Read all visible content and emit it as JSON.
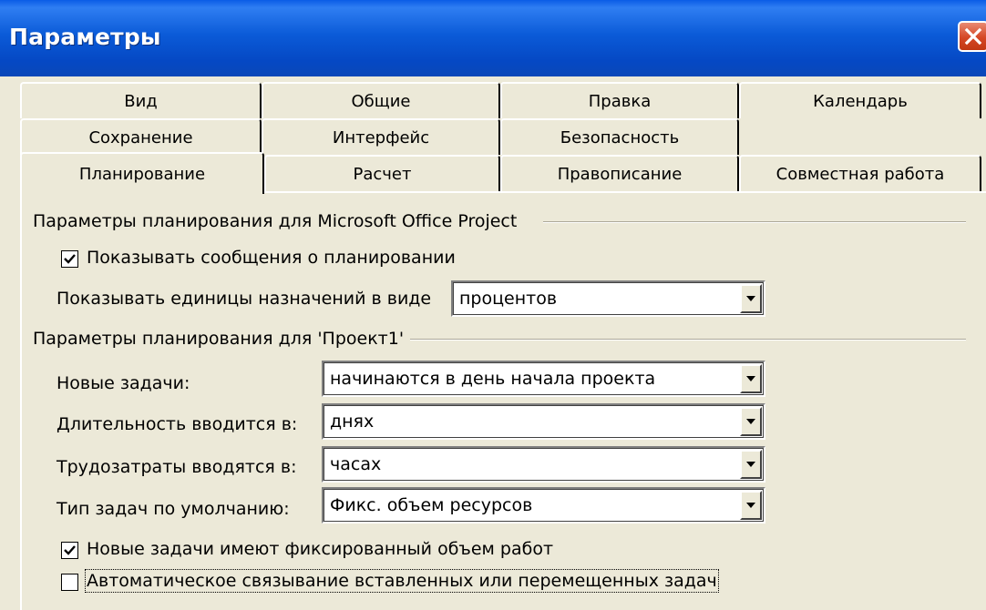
{
  "window": {
    "title": "Параметры"
  },
  "tabs": {
    "row1": [
      "Вид",
      "Общие",
      "Правка",
      "Календарь"
    ],
    "row2": [
      "Сохранение",
      "Интерфейс",
      "Безопасность"
    ],
    "row3": [
      "Планирование",
      "Расчет",
      "Правописание",
      "Совместная работа"
    ],
    "active": "Планирование"
  },
  "section1": {
    "heading": "Параметры планирования для Microsoft Office Project",
    "show_messages": {
      "label": "Показывать сообщения о планировании",
      "checked": true
    },
    "units": {
      "label": "Показывать единицы назначений в виде",
      "value": "процентов"
    }
  },
  "section2": {
    "heading": "Параметры планирования для 'Проект1'",
    "new_tasks": {
      "label": "Новые задачи:",
      "value": "начинаются в день начала проекта"
    },
    "duration": {
      "label": "Длительность вводится в:",
      "value": "днях"
    },
    "work": {
      "label": "Трудозатраты вводятся в:",
      "value": "часах"
    },
    "task_type": {
      "label": "Тип задач по умолчанию:",
      "value": "Фикс. объем ресурсов"
    },
    "effort_driven": {
      "label": "Новые задачи имеют фиксированный объем работ",
      "checked": true
    },
    "autolink": {
      "label": "Автоматическое связывание вставленных или перемещенных задач",
      "checked": false
    }
  }
}
